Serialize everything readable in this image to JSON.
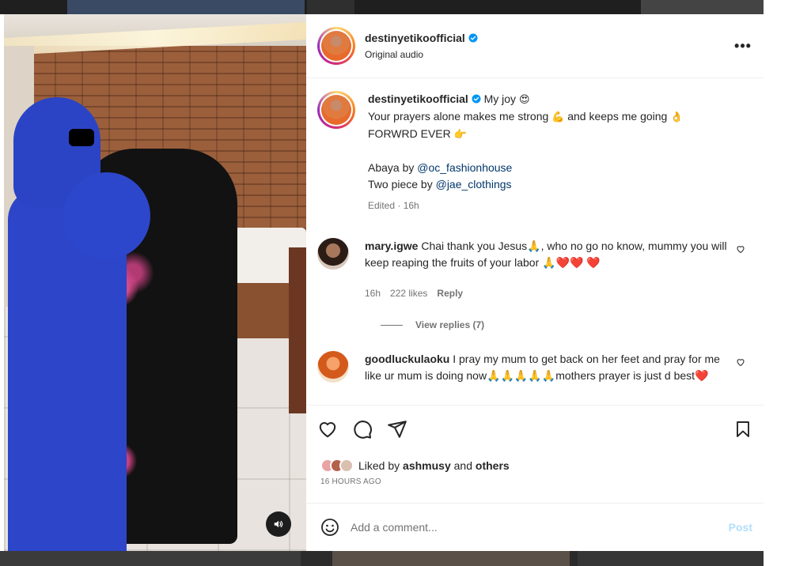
{
  "header": {
    "username": "destinyetikoofficial",
    "subtitle": "Original audio",
    "more_label": "•••"
  },
  "caption": {
    "username": "destinyetikoofficial",
    "line1": "My joy",
    "line1_emoji": "😍",
    "line2a": "Your prayers alone makes me strong",
    "line2_emoji1": "💪",
    "line2b": "and keeps me going",
    "line2_emoji2": "👌",
    "line3": "FORWRD EVER",
    "line3_emoji": "👉",
    "abaya_prefix": "Abaya by",
    "abaya_mention": "@oc_fashionhouse",
    "twopiece_prefix": "Two piece by",
    "twopiece_mention": "@jae_clothings",
    "meta": "Edited · 16h"
  },
  "comments": [
    {
      "username": "mary.igwe",
      "text": "Chai thank you Jesus🙏, who no go no know, mummy you will keep reaping the fruits of your labor 🙏❤️❤️ ❤️",
      "time": "16h",
      "likes": "222 likes",
      "reply_label": "Reply",
      "view_replies": "View replies (7)"
    },
    {
      "username": "goodluckulaoku",
      "text": "I pray my mum to get back on her feet and pray for me like ur mum is doing now🙏🙏🙏🙏🙏mothers prayer is just d best❤️"
    }
  ],
  "likes": {
    "prefix": "Liked by",
    "user": "ashmusy",
    "joiner": "and",
    "others": "others"
  },
  "time_ago": "16 HOURS AGO",
  "add_comment": {
    "placeholder": "Add a comment...",
    "post_label": "Post"
  },
  "colors": {
    "link": "#00376b",
    "verified": "#0095f6",
    "post_disabled": "#b2dffc",
    "muted": "#737373"
  },
  "icons": [
    "verified-badge-icon",
    "more-icon",
    "heart-icon",
    "comment-icon",
    "share-icon",
    "bookmark-icon",
    "emoji-icon",
    "sound-icon"
  ]
}
